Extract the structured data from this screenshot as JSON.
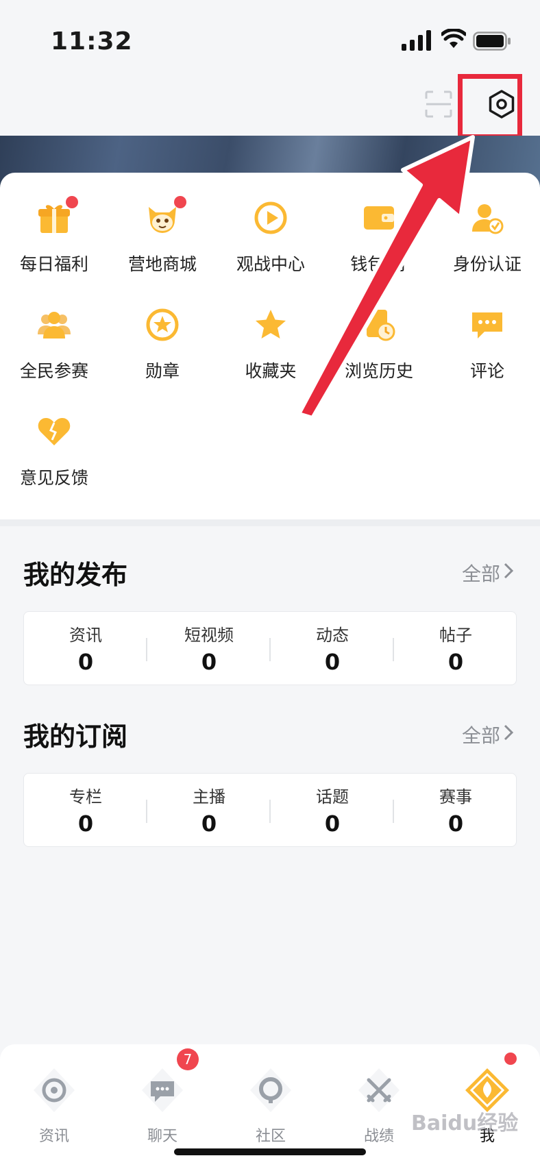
{
  "status_bar": {
    "time": "11:32"
  },
  "grid_items": [
    {
      "label": "每日福利",
      "icon": "gift-icon",
      "badge": true
    },
    {
      "label": "营地商城",
      "icon": "mascot-icon",
      "badge": true
    },
    {
      "label": "观战中心",
      "icon": "play-icon",
      "badge": false
    },
    {
      "label": "钱包/订",
      "icon": "wallet-icon",
      "badge": false
    },
    {
      "label": "身份认证",
      "icon": "verify-icon",
      "badge": false
    },
    {
      "label": "全民参赛",
      "icon": "team-icon",
      "badge": false
    },
    {
      "label": "勋章",
      "icon": "medal-icon",
      "badge": false
    },
    {
      "label": "收藏夹",
      "icon": "star-icon",
      "badge": false
    },
    {
      "label": "浏览历史",
      "icon": "history-icon",
      "badge": false
    },
    {
      "label": "评论",
      "icon": "comment-icon",
      "badge": false
    },
    {
      "label": "意见反馈",
      "icon": "feedback-icon",
      "badge": false
    }
  ],
  "my_posts": {
    "title": "我的发布",
    "all_label": "全部",
    "stats": [
      {
        "label": "资讯",
        "value": "0"
      },
      {
        "label": "短视频",
        "value": "0"
      },
      {
        "label": "动态",
        "value": "0"
      },
      {
        "label": "帖子",
        "value": "0"
      }
    ]
  },
  "my_subs": {
    "title": "我的订阅",
    "all_label": "全部",
    "stats": [
      {
        "label": "专栏",
        "value": "0"
      },
      {
        "label": "主播",
        "value": "0"
      },
      {
        "label": "话题",
        "value": "0"
      },
      {
        "label": "赛事",
        "value": "0"
      }
    ]
  },
  "bottom_nav": [
    {
      "label": "资讯",
      "icon": "news-icon"
    },
    {
      "label": "聊天",
      "icon": "chat-icon",
      "badge": "7"
    },
    {
      "label": "社区",
      "icon": "community-icon"
    },
    {
      "label": "战绩",
      "icon": "record-icon"
    },
    {
      "label": "我",
      "icon": "me-icon",
      "active": true
    }
  ],
  "watermark": "Baidu经验",
  "colors": {
    "accent": "#fbb933",
    "badge": "#f0464f",
    "annotation": "#e8293c"
  }
}
